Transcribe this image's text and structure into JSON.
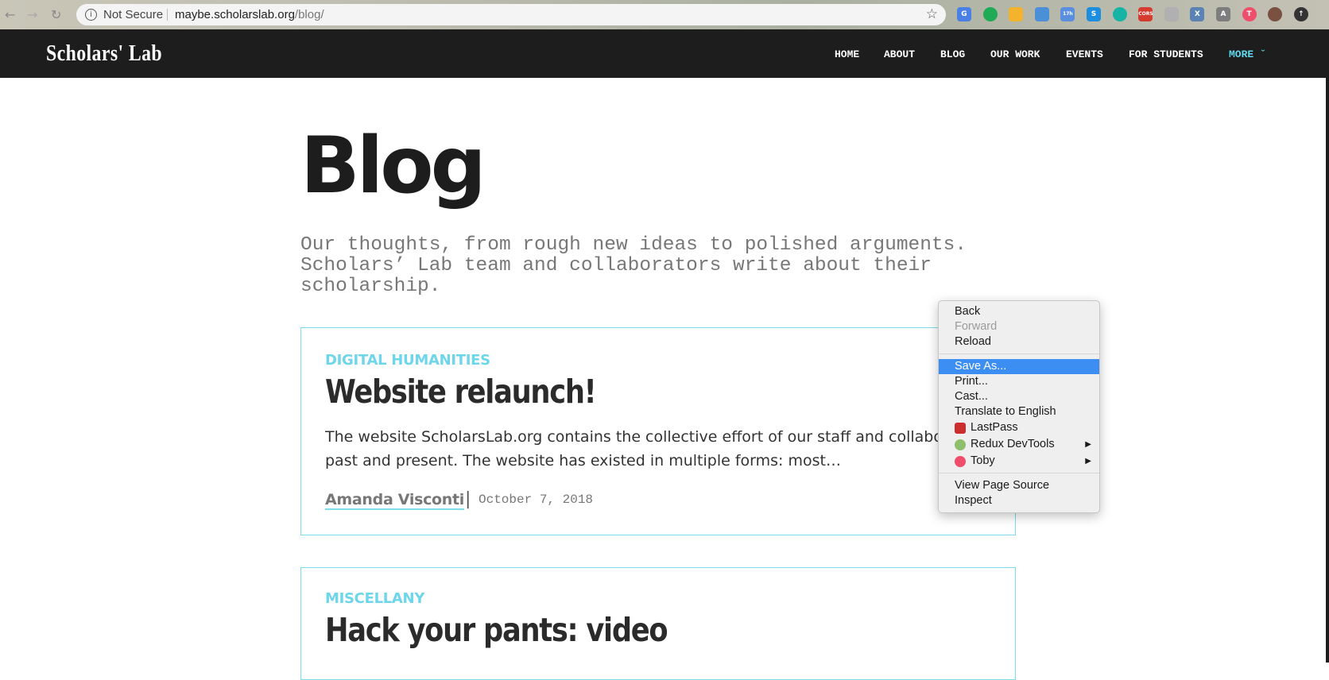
{
  "browser": {
    "not_secure": "Not Secure",
    "url_host": "maybe.scholarslab.org",
    "url_path": "/blog/",
    "extensions": [
      {
        "name": "translate",
        "color": "#4a7fe6",
        "label": "G"
      },
      {
        "name": "hangouts",
        "color": "#1faa55",
        "label": ""
      },
      {
        "name": "drive",
        "color": "#f3b32c",
        "label": ""
      },
      {
        "name": "ext-blue",
        "color": "#4b8fd9",
        "label": ""
      },
      {
        "name": "calendar",
        "color": "#5a8fe0",
        "label": "17h"
      },
      {
        "name": "skype",
        "color": "#1c8ee0",
        "label": "S"
      },
      {
        "name": "teal",
        "color": "#17b4a6",
        "label": ""
      },
      {
        "name": "cors",
        "color": "#d63b2f",
        "label": "CORS"
      },
      {
        "name": "cast",
        "color": "#b0b0b0",
        "label": ""
      },
      {
        "name": "ext-x",
        "color": "#5a82b3",
        "label": "X"
      },
      {
        "name": "angular",
        "color": "#7d7d7d",
        "label": "A"
      },
      {
        "name": "toby",
        "color": "#ef4e6a",
        "label": "T"
      },
      {
        "name": "avatar",
        "color": "#7a5040",
        "label": ""
      },
      {
        "name": "up",
        "color": "#333",
        "label": "↑"
      }
    ]
  },
  "site": {
    "logo": "Scholars' Lab",
    "nav": [
      "HOME",
      "ABOUT",
      "BLOG",
      "OUR WORK",
      "EVENTS",
      "FOR STUDENTS",
      "MORE ˇ"
    ]
  },
  "page": {
    "title": "Blog",
    "intro": "Our thoughts, from rough new ideas to polished arguments. Scholars’ Lab team and collaborators write about their scholarship."
  },
  "posts": [
    {
      "category": "DIGITAL HUMANITIES",
      "title": "Website relaunch!",
      "excerpt_1": "The website ScholarsLab.org contains the collective effort of our staff and collaborators",
      "excerpt_2": "past and present. The website has existed in multiple forms: most…",
      "author": "Amanda Visconti",
      "separator": "|",
      "date": "October 7, 2018"
    },
    {
      "category": "MISCELLANY",
      "title": "Hack your pants: video"
    }
  ],
  "context_menu": {
    "items": [
      "Back",
      "Forward",
      "Reload",
      "Save As...",
      "Print...",
      "Cast...",
      "Translate to English",
      "LastPass",
      "Redux DevTools",
      "Toby",
      "View Page Source",
      "Inspect"
    ],
    "submenu_arrow": "▶"
  }
}
